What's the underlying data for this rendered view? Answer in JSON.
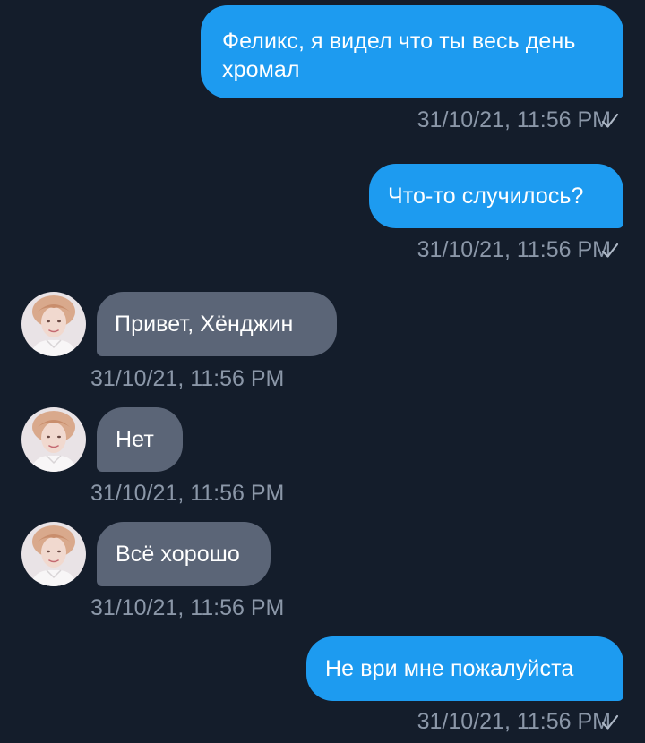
{
  "messages": [
    {
      "direction": "out",
      "text": "Феликс, я видел что ты весь день хромал",
      "timestamp": "31/10/21, 11:56 PM",
      "status": "sent-check-icon"
    },
    {
      "direction": "out",
      "text": "Что-то случилось?",
      "timestamp": "31/10/21, 11:56 PM",
      "status": "sent-check-icon"
    },
    {
      "direction": "in",
      "text": "Привет, Хёнджин",
      "timestamp": "31/10/21, 11:56 PM",
      "avatar": "contact-avatar"
    },
    {
      "direction": "in",
      "text": "Нет",
      "timestamp": "31/10/21, 11:56 PM",
      "avatar": "contact-avatar"
    },
    {
      "direction": "in",
      "text": "Всё хорошо",
      "timestamp": "31/10/21, 11:56 PM",
      "avatar": "contact-avatar"
    },
    {
      "direction": "out",
      "text": "Не ври мне пожалуйста",
      "timestamp": "31/10/21, 11:56 PM",
      "status": "sent-check-icon"
    }
  ],
  "colors": {
    "background": "#141d2b",
    "outgoing_bubble": "#1d9bf0",
    "incoming_bubble": "#5b6577",
    "timestamp": "#8b97a8"
  }
}
